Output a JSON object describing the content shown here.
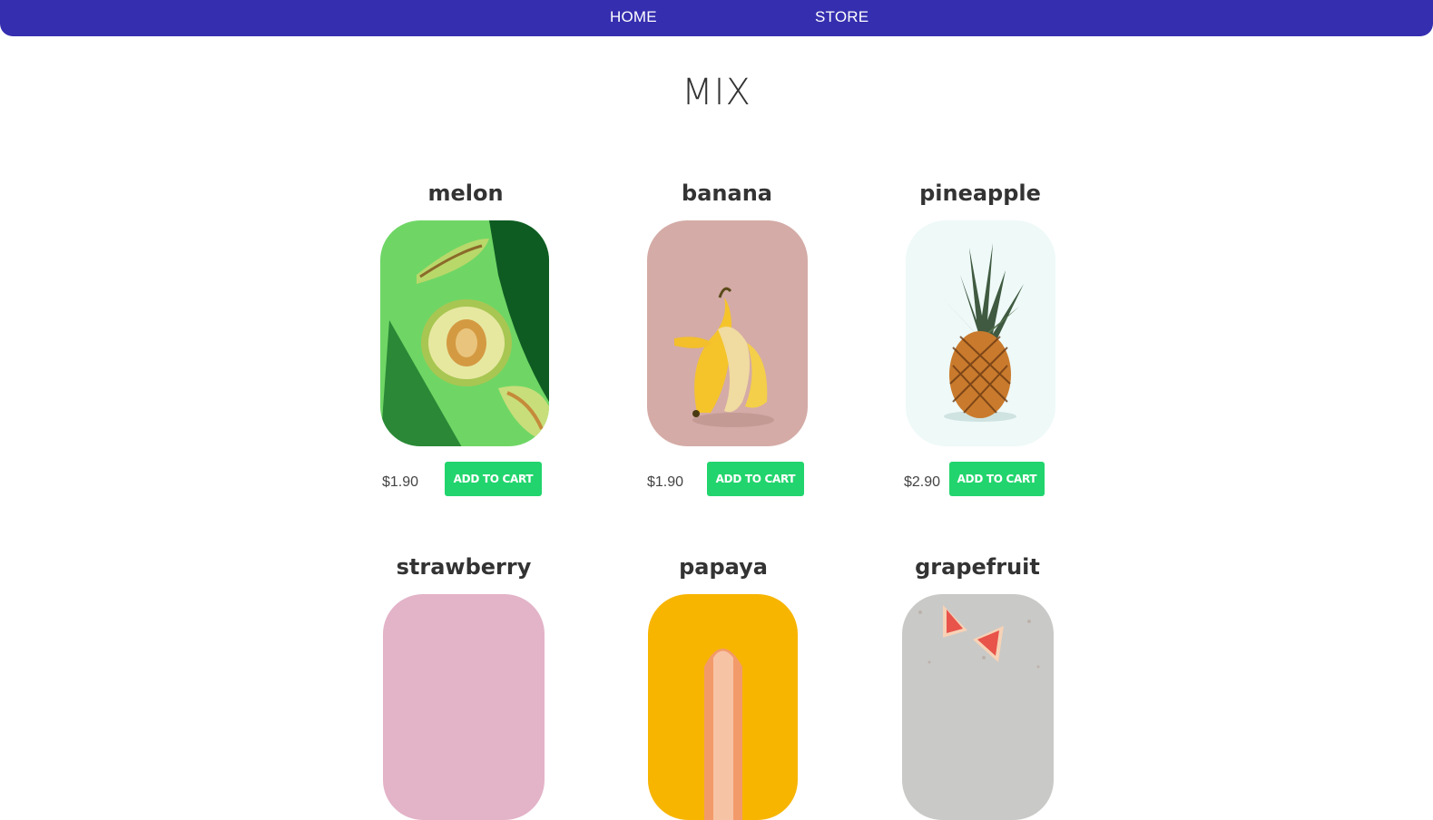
{
  "nav": {
    "home_label": "HOME",
    "store_label": "STORE",
    "background": "#352eaf"
  },
  "page": {
    "title": "MIX"
  },
  "products": [
    {
      "name": "melon",
      "price": "$1.90",
      "button_label": "ADD TO CART",
      "image_bg": "#6fd665"
    },
    {
      "name": "banana",
      "price": "$1.90",
      "button_label": "ADD TO CART",
      "image_bg": "#d4aba6"
    },
    {
      "name": "pineapple",
      "price": "$2.90",
      "button_label": "ADD TO CART",
      "image_bg": "#eef9f8"
    },
    {
      "name": "strawberry",
      "image_bg": "#e3b3c8"
    },
    {
      "name": "papaya",
      "image_bg": "#f7b500"
    },
    {
      "name": "grapefruit",
      "image_bg": "#c9c9c7"
    }
  ],
  "accent": {
    "button": "#22d46d"
  }
}
